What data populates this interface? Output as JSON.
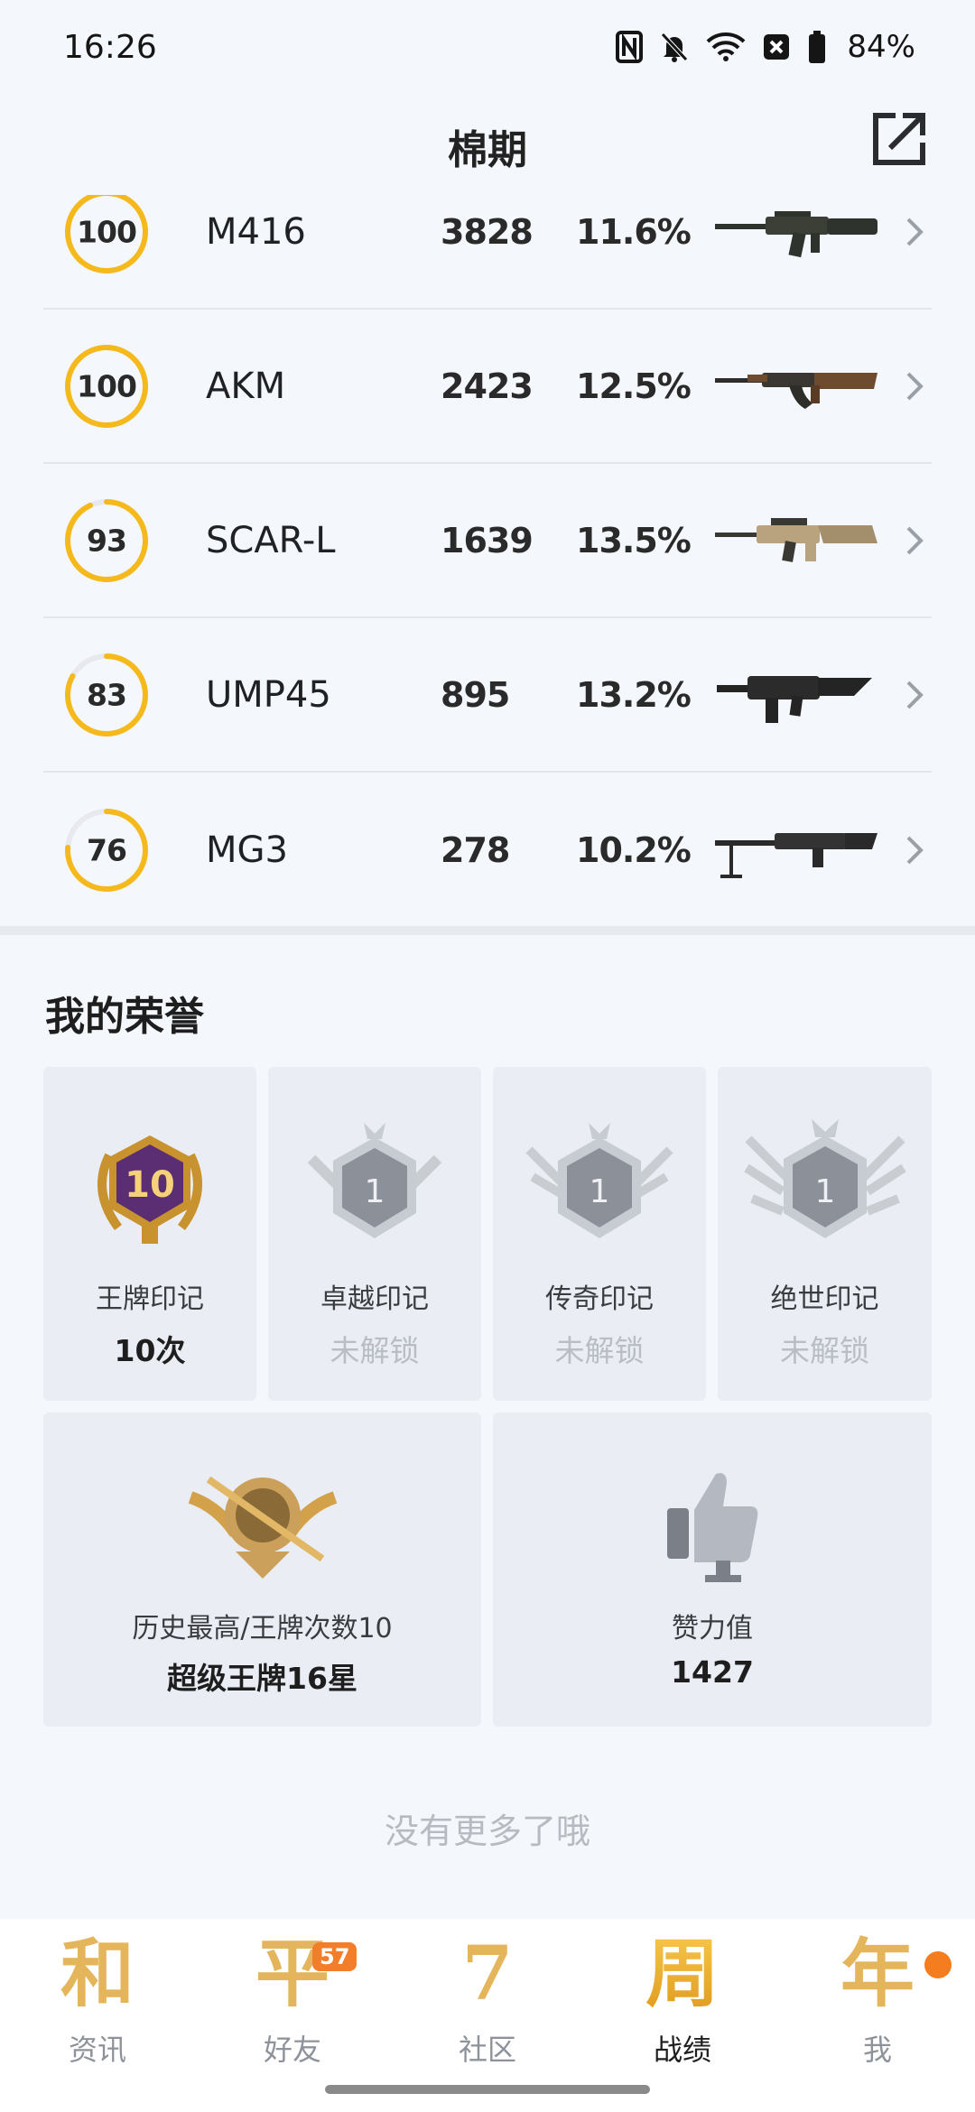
{
  "status_bar": {
    "time": "16:26",
    "battery": "84%"
  },
  "header": {
    "title": "棉期"
  },
  "weapons": [
    {
      "score": "100",
      "level": 1.0,
      "name": "M416",
      "count": "3828",
      "rate": "11.6%"
    },
    {
      "score": "100",
      "level": 1.0,
      "name": "AKM",
      "count": "2423",
      "rate": "12.5%"
    },
    {
      "score": "93",
      "level": 0.93,
      "name": "SCAR-L",
      "count": "1639",
      "rate": "13.5%"
    },
    {
      "score": "83",
      "level": 0.83,
      "name": "UMP45",
      "count": "895",
      "rate": "13.2%"
    },
    {
      "score": "76",
      "level": 0.76,
      "name": "MG3",
      "count": "278",
      "rate": "10.2%"
    }
  ],
  "honors": {
    "title": "我的荣誉",
    "badges": [
      {
        "label": "王牌印记",
        "value": "10次",
        "badge_number": "10"
      },
      {
        "label": "卓越印记",
        "value": "未解锁",
        "badge_number": "1"
      },
      {
        "label": "传奇印记",
        "value": "未解锁",
        "badge_number": "1"
      },
      {
        "label": "绝世印记",
        "value": "未解锁",
        "badge_number": "1"
      }
    ],
    "highest": {
      "label": "历史最高/王牌次数10",
      "value": "超级王牌16星"
    },
    "likes": {
      "label": "赞力值",
      "value": "1427"
    }
  },
  "footer_note": "没有更多了哦",
  "tabs": [
    {
      "glyph": "和",
      "label": "资讯"
    },
    {
      "glyph": "平",
      "label": "好友",
      "badge": "57"
    },
    {
      "glyph": "7",
      "label": "社区"
    },
    {
      "glyph": "周",
      "label": "战绩"
    },
    {
      "glyph": "年",
      "label": "我"
    }
  ],
  "colors": {
    "ring": "#f5b91b",
    "ring_track": "#e7e9ee",
    "accent": "#f27d2a"
  }
}
